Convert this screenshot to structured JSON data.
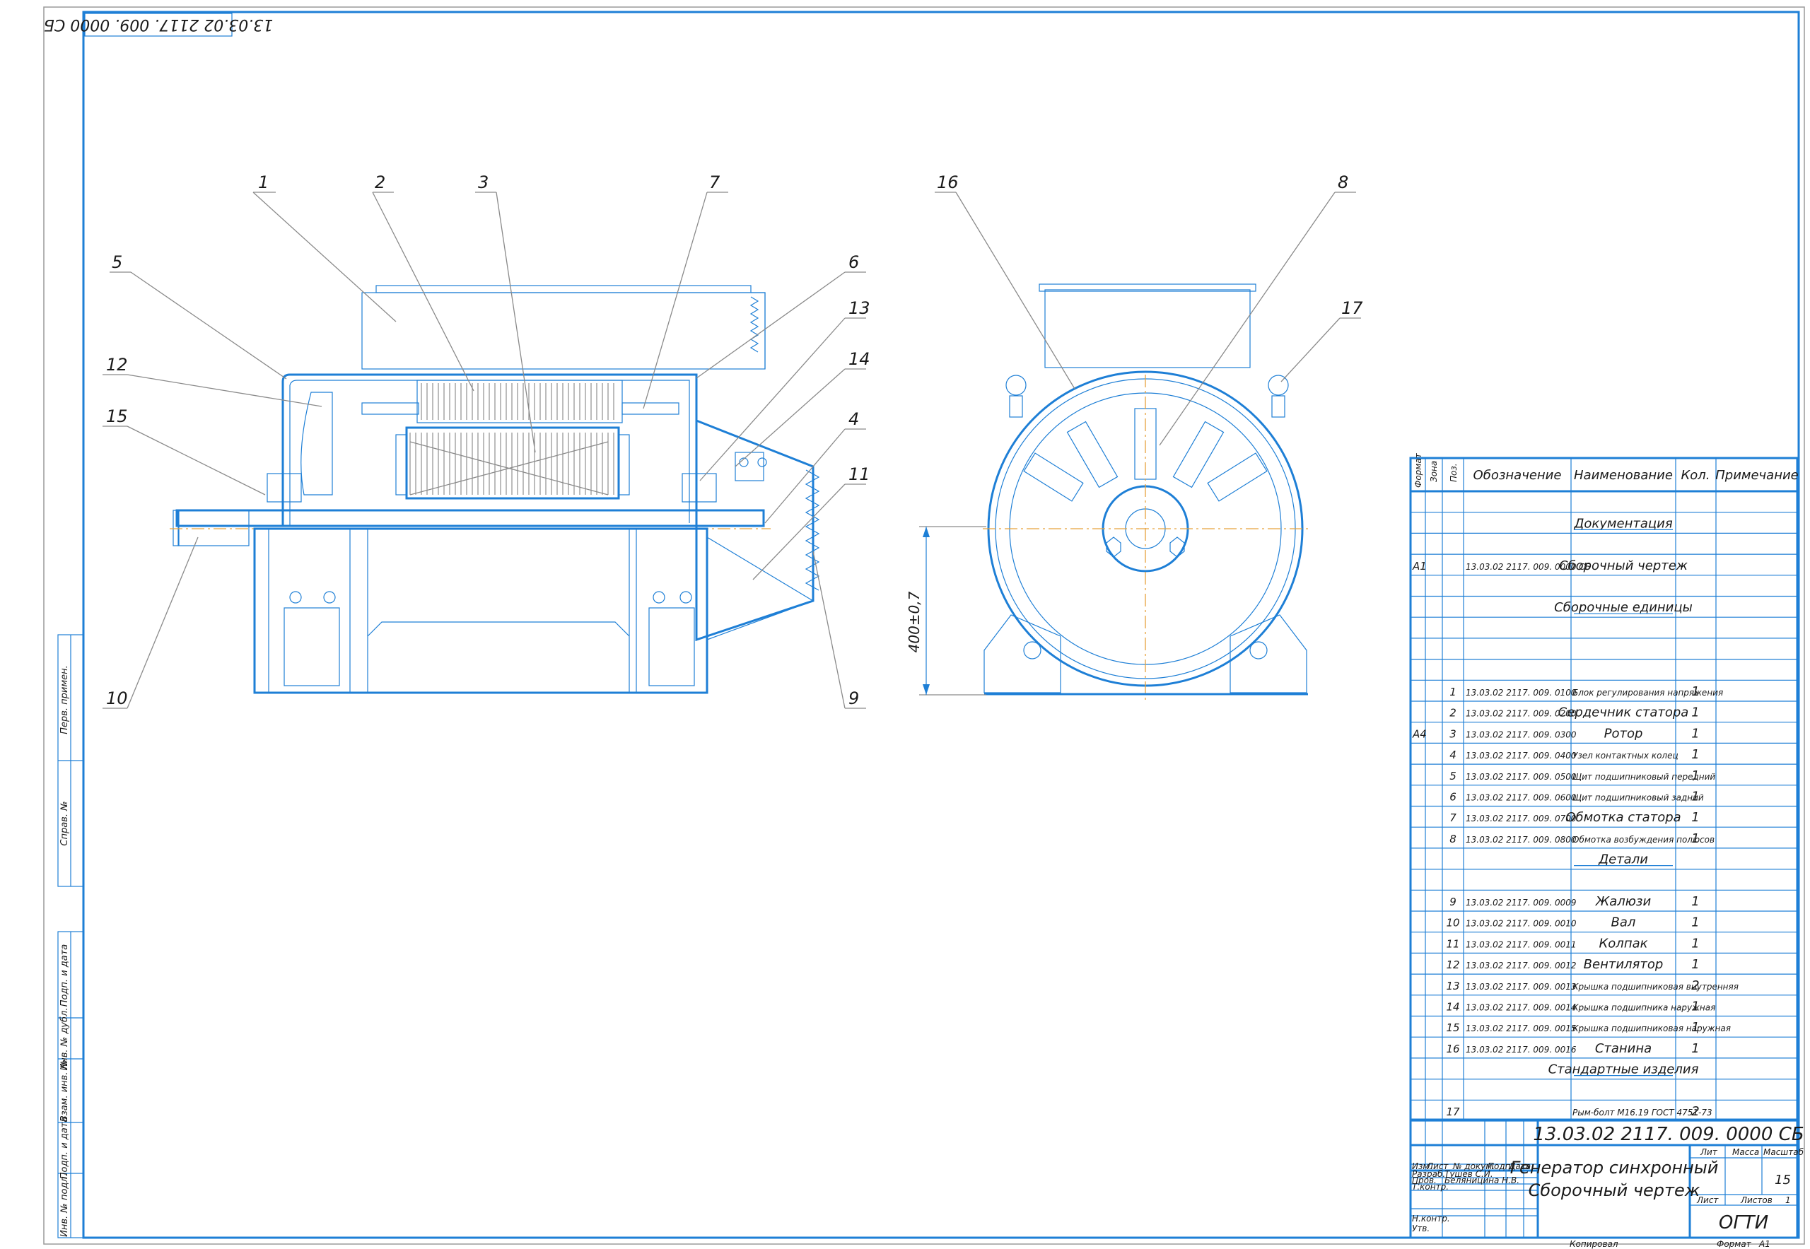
{
  "stamp_top": "13.03.02 2117. 009. 0000 СБ",
  "side_labels": [
    "Перв. примен.",
    "Справ. №",
    "Подп. и дата",
    "Инв. № дубл.",
    "Взам. инв. №",
    "Подп. и дата",
    "Инв. № подл."
  ],
  "callouts": [
    "1",
    "2",
    "3",
    "4",
    "5",
    "6",
    "7",
    "8",
    "9",
    "10",
    "11",
    "12",
    "13",
    "14",
    "15",
    "16",
    "17"
  ],
  "dimension": "400±0,7",
  "spec": {
    "headers": {
      "format": "Формат",
      "zone": "Зона",
      "pos": "Поз.",
      "designation": "Обозначение",
      "name": "Наименование",
      "qty": "Кол.",
      "note": "Примечание"
    },
    "rows": [
      {
        "format": "",
        "pos": "",
        "designation": "",
        "name": "Документация",
        "qty": ""
      },
      {
        "format": "А1",
        "pos": "",
        "designation": "13.03.02 2117. 009. 0000 СБ",
        "name": "Сборочный чертеж",
        "qty": ""
      },
      {
        "format": "",
        "pos": "",
        "designation": "",
        "name": "Сборочные единицы",
        "qty": ""
      },
      {
        "format": "",
        "pos": "1",
        "designation": "13.03.02 2117. 009. 0100",
        "name": "Блок регулирования напряжения",
        "qty": "1"
      },
      {
        "format": "",
        "pos": "2",
        "designation": "13.03.02 2117. 009. 0200",
        "name": "Сердечник статора",
        "qty": "1"
      },
      {
        "format": "А4",
        "pos": "3",
        "designation": "13.03.02 2117. 009. 0300",
        "name": "Ротор",
        "qty": "1"
      },
      {
        "format": "",
        "pos": "4",
        "designation": "13.03.02 2117. 009. 0400",
        "name": "Узел контактных колец",
        "qty": "1"
      },
      {
        "format": "",
        "pos": "5",
        "designation": "13.03.02 2117. 009. 0500",
        "name": "Щит подшипниковый передний",
        "qty": "1"
      },
      {
        "format": "",
        "pos": "6",
        "designation": "13.03.02 2117. 009. 0600",
        "name": "Щит подшипниковый задний",
        "qty": "1"
      },
      {
        "format": "",
        "pos": "7",
        "designation": "13.03.02 2117. 009. 0700",
        "name": "Обмотка статора",
        "qty": "1"
      },
      {
        "format": "",
        "pos": "8",
        "designation": "13.03.02 2117. 009. 0800",
        "name": "Обмотка возбуждения полюсов",
        "qty": "1"
      },
      {
        "format": "",
        "pos": "",
        "designation": "",
        "name": "Детали",
        "qty": ""
      },
      {
        "format": "",
        "pos": "9",
        "designation": "13.03.02 2117. 009. 0009",
        "name": "Жалюзи",
        "qty": "1"
      },
      {
        "format": "",
        "pos": "10",
        "designation": "13.03.02 2117. 009. 0010",
        "name": "Вал",
        "qty": "1"
      },
      {
        "format": "",
        "pos": "11",
        "designation": "13.03.02 2117. 009. 0011",
        "name": "Колпак",
        "qty": "1"
      },
      {
        "format": "",
        "pos": "12",
        "designation": "13.03.02 2117. 009. 0012",
        "name": "Вентилятор",
        "qty": "1"
      },
      {
        "format": "",
        "pos": "13",
        "designation": "13.03.02 2117. 009. 0013",
        "name": "Крышка подшипниковая внутренняя",
        "qty": "2"
      },
      {
        "format": "",
        "pos": "14",
        "designation": "13.03.02 2117. 009. 0014",
        "name": "Крышка подшипника наружная",
        "qty": "1"
      },
      {
        "format": "",
        "pos": "15",
        "designation": "13.03.02 2117. 009. 0015",
        "name": "Крышка подшипниковая наружная",
        "qty": "1"
      },
      {
        "format": "",
        "pos": "16",
        "designation": "13.03.02 2117. 009. 0016",
        "name": "Станина",
        "qty": "1"
      },
      {
        "format": "",
        "pos": "",
        "designation": "",
        "name": "Стандартные изделия",
        "qty": ""
      },
      {
        "format": "",
        "pos": "17",
        "designation": "",
        "name": "Рым-болт М16.19 ГОСТ 4751-73",
        "qty": "2"
      }
    ]
  },
  "title_block": {
    "code": "13.03.02 2117. 009. 0000 СБ",
    "title_line1": "Генератор синхронный",
    "title_line2": "Сборочный чертеж",
    "col_izm": "Изм.",
    "col_list": "Лист",
    "col_ndoc": "№ докум.",
    "col_podp": "Подп.",
    "col_data": "Дата",
    "role_razrab": "Разраб.",
    "name_razrab": "Тушев С.И.",
    "role_prov": "Пров.",
    "name_prov": "Беляницина Н.В.",
    "role_tkontr": "Т.контр.",
    "role_nkontr": "Н.контр.",
    "role_utv": "Утв.",
    "lit": "Лит",
    "massa": "Масса",
    "masshtab": "Масштаб",
    "scale_value": "15",
    "list": "Лист",
    "listov": "Листов",
    "listov_value": "1",
    "org": "ОГТИ",
    "kopiroval": "Копировал",
    "format": "Формат",
    "format_value": "А1"
  }
}
